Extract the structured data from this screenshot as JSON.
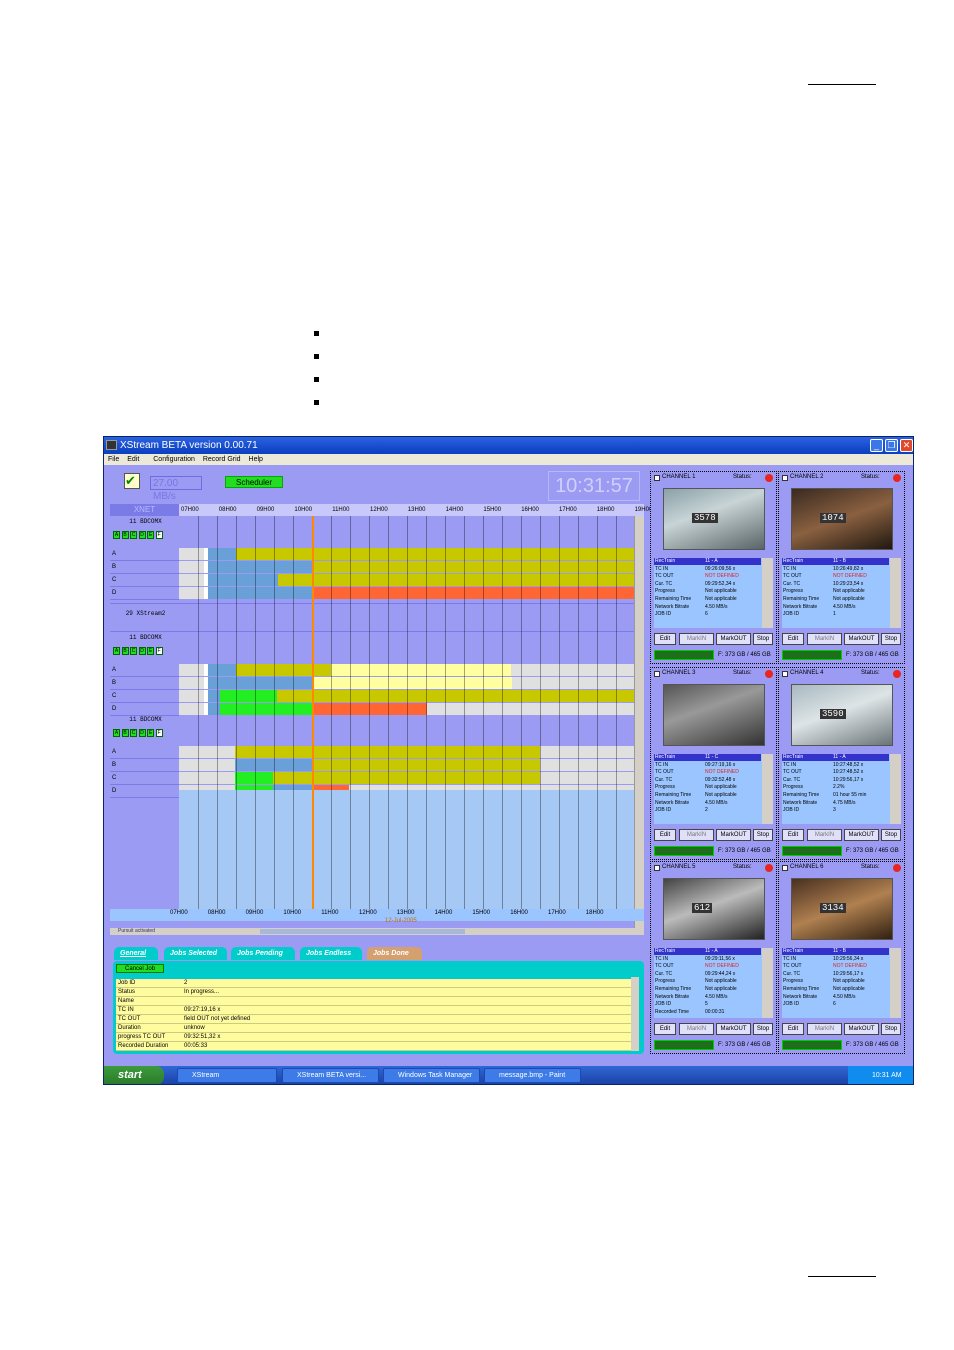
{
  "window": {
    "title": "XStream  BETA version  0.00.71"
  },
  "menu": [
    "File",
    "Edit",
    "",
    "Configuration",
    "Record Grid",
    "Help"
  ],
  "toolbar": {
    "rate": "27.00 MB/s",
    "scheduler_label": "Scheduler",
    "clock": "10:31:57"
  },
  "grid": {
    "xnet_label": "XNET",
    "hours_top": [
      "07H00",
      "08H00",
      "09H00",
      "10H00",
      "11H00",
      "12H00",
      "13H00",
      "14H00",
      "15H00",
      "16H00",
      "17H00",
      "18H00",
      "19H00"
    ],
    "hours_bottom": [
      "07H00",
      "08H00",
      "09H00",
      "10H00",
      "11H00",
      "12H00",
      "13H00",
      "14H00",
      "15H00",
      "16H00",
      "17H00",
      "18H00"
    ],
    "date": "12-Jul-2005",
    "pursuit": "Pursuit activated",
    "groups": [
      {
        "name": "11 BDCOMX",
        "buttons": [
          "A",
          "B",
          "C",
          "D",
          "E",
          "F"
        ],
        "rows": [
          "A",
          "B",
          "C",
          "D"
        ]
      },
      {
        "name": "29 XStream2"
      },
      {
        "name": "11 BDCOMX",
        "buttons": [
          "A",
          "B",
          "C",
          "D",
          "E",
          "F"
        ],
        "rows": [
          "A",
          "B",
          "C",
          "D"
        ]
      },
      {
        "name": "11 BDCOMX",
        "buttons": [
          "A",
          "B",
          "C",
          "D",
          "E",
          "F"
        ],
        "rows": [
          "A",
          "B",
          "C",
          "D"
        ]
      }
    ]
  },
  "tabs": [
    "General",
    "Jobs Selected",
    "Jobs Pending",
    "Jobs Endless",
    "Jobs Done"
  ],
  "cancel_job": "Cancel Job",
  "job_details": [
    {
      "k": "Job ID",
      "v": "2"
    },
    {
      "k": "Status",
      "v": "In progress..."
    },
    {
      "k": "Name",
      "v": ""
    },
    {
      "k": "TC IN",
      "v": "09:27:19,16 x"
    },
    {
      "k": "TC OUT",
      "v": "field OUT not yet defined"
    },
    {
      "k": "Duration",
      "v": "unknow"
    },
    {
      "k": "progress TC OUT",
      "v": "09:32:51,32 x"
    },
    {
      "k": "Recorded Duration",
      "v": "00:05:33"
    }
  ],
  "channels": [
    {
      "name": "CHANNEL 1",
      "status": "Status:",
      "tc": "3578",
      "rows": [
        [
          "RecTrain",
          "11 - A"
        ],
        [
          "TC IN",
          "09:26:09,56 x"
        ],
        [
          "TC OUT",
          "NOT DEFINED"
        ],
        [
          "Cur. TC",
          "09:29:52,34 x"
        ],
        [
          "Progress",
          "Not applicable"
        ],
        [
          "Remaining Time",
          "Not applicable"
        ],
        [
          "Network Bitrate",
          "4.50 MB/s"
        ],
        [
          "JOB ID",
          "6"
        ]
      ],
      "free": "F: 373 GB / 465 GB",
      "btns": [
        "Edit",
        "MarkIN",
        "MarkOUT",
        "Stop"
      ]
    },
    {
      "name": "CHANNEL 2",
      "status": "Status:",
      "tc": "1074",
      "rows": [
        [
          "RecTrain",
          "11 - B"
        ],
        [
          "TC IN",
          "10:26:49,82 x"
        ],
        [
          "TC OUT",
          "NOT DEFINED"
        ],
        [
          "Cur. TC",
          "10:29:23,54 x"
        ],
        [
          "Progress",
          "Not applicable"
        ],
        [
          "Remaining Time",
          "Not applicable"
        ],
        [
          "Network Bitrate",
          "4.50 MB/s"
        ],
        [
          "JOB ID",
          "1"
        ]
      ],
      "free": "F: 373 GB / 465 GB",
      "btns": [
        "Edit",
        "MarkIN",
        "MarkOUT",
        "Stop"
      ]
    },
    {
      "name": "CHANNEL 3",
      "status": "Status:",
      "tc": "",
      "rows": [
        [
          "RecTrain",
          "11 - C"
        ],
        [
          "TC IN",
          "09:27:19,16 x"
        ],
        [
          "TC OUT",
          "NOT DEFINED"
        ],
        [
          "Cur. TC",
          "09:32:52,48 x"
        ],
        [
          "Progress",
          "Not applicable"
        ],
        [
          "Remaining Time",
          "Not applicable"
        ],
        [
          "Network Bitrate",
          "4.50 MB/s"
        ],
        [
          "JOB ID",
          "2"
        ]
      ],
      "free": "F: 373 GB / 465 GB",
      "btns": [
        "Edit",
        "MarkIN",
        "MarkOUT",
        "Stop"
      ]
    },
    {
      "name": "CHANNEL 4",
      "status": "Status:",
      "tc": "3590",
      "rows": [
        [
          "RecTrain",
          "11 - A"
        ],
        [
          "TC IN",
          "10:27:48,52 x"
        ],
        [
          "TC OUT",
          "10:27:48,52 x"
        ],
        [
          "Cur. TC",
          "10:29:56,17 x"
        ],
        [
          "Progress",
          "2.2%"
        ],
        [
          "Remaining Time",
          "01 hour 55 min"
        ],
        [
          "Network Bitrate",
          "4.75 MB/s"
        ],
        [
          "JOB ID",
          "3"
        ]
      ],
      "free": "F: 373 GB / 465 GB",
      "btns": [
        "Edit",
        "MarkIN",
        "MarkOUT",
        "Stop"
      ]
    },
    {
      "name": "CHANNEL 5",
      "status": "Status:",
      "tc": "612",
      "rows": [
        [
          "RecTrain",
          "11 - A"
        ],
        [
          "TC IN",
          "09:29:11,56 x"
        ],
        [
          "TC OUT",
          "NOT DEFINED"
        ],
        [
          "Cur. TC",
          "09:29:44,24 x"
        ],
        [
          "Progress",
          "Not applicable"
        ],
        [
          "Remaining Time",
          "Not applicable"
        ],
        [
          "Network Bitrate",
          "4.50 MB/s"
        ],
        [
          "JOB ID",
          "5"
        ],
        [
          "Recorded Time",
          "00:00:31"
        ]
      ],
      "free": "F: 373 GB / 465 GB",
      "btns": [
        "Edit",
        "MarkIN",
        "MarkOUT",
        "Stop"
      ]
    },
    {
      "name": "CHANNEL 6",
      "status": "Status:",
      "tc": "3134",
      "rows": [
        [
          "RecTrain",
          "11 - B"
        ],
        [
          "TC IN",
          "10:29:56,34 x"
        ],
        [
          "TC OUT",
          "NOT DEFINED"
        ],
        [
          "Cur. TC",
          "10:29:56,17 x"
        ],
        [
          "Progress",
          "Not applicable"
        ],
        [
          "Remaining Time",
          "Not applicable"
        ],
        [
          "Network Bitrate",
          "4.50 MB/s"
        ],
        [
          "JOB ID",
          "6"
        ]
      ],
      "free": "F: 373 GB / 465 GB",
      "btns": [
        "Edit",
        "MarkIN",
        "MarkOUT",
        "Stop"
      ]
    }
  ],
  "taskbar": {
    "start": "start",
    "tasks": [
      "XStream",
      "XStream  BETA versi...",
      "Windows Task Manager",
      "message.bmp - Paint"
    ],
    "time": "10:31 AM"
  },
  "colors": {
    "yellow": "#c8c800",
    "blue": "#6aa0d8",
    "orange": "#ff6633",
    "green": "#22ee22",
    "lightyellow": "#ffffa0",
    "gray": "#e0e0e0",
    "cursor": "#ff8800"
  }
}
